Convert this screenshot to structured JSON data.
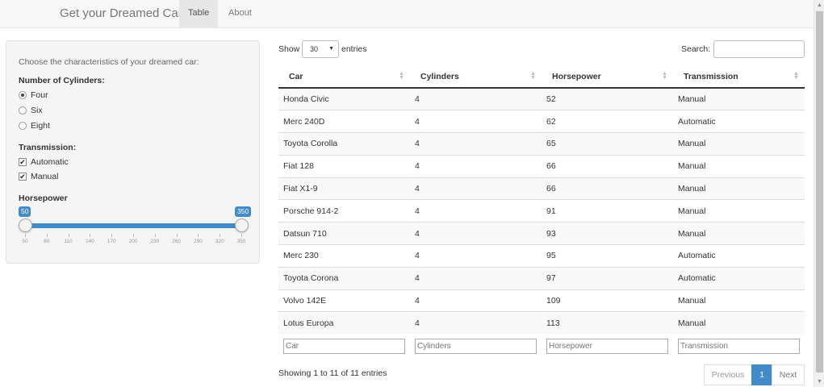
{
  "navbar": {
    "brand": "Get your Dreamed Car",
    "tabs": [
      {
        "label": "Table",
        "active": true
      },
      {
        "label": "About",
        "active": false
      }
    ]
  },
  "sidebar": {
    "intro": "Choose the characteristics of your dreamed car:",
    "cylinders": {
      "label": "Number of Cylinders:",
      "options": [
        {
          "label": "Four",
          "selected": true
        },
        {
          "label": "Six",
          "selected": false
        },
        {
          "label": "Eight",
          "selected": false
        }
      ]
    },
    "transmission": {
      "label": "Transmission:",
      "options": [
        {
          "label": "Automatic",
          "checked": true
        },
        {
          "label": "Manual",
          "checked": true
        }
      ]
    },
    "horsepower": {
      "label": "Horsepower",
      "min": 50,
      "max": 350,
      "from": "50",
      "to": "350",
      "ticks": [
        "50",
        "80",
        "110",
        "140",
        "170",
        "200",
        "230",
        "260",
        "290",
        "320",
        "350"
      ]
    }
  },
  "table_controls": {
    "show_label": "Show",
    "page_length": "30",
    "entries_label": "entries",
    "search_label": "Search:",
    "search_value": ""
  },
  "table": {
    "columns": [
      "Car",
      "Cylinders",
      "Horsepower",
      "Transmission"
    ],
    "rows": [
      [
        "Honda Civic",
        "4",
        "52",
        "Manual"
      ],
      [
        "Merc 240D",
        "4",
        "62",
        "Automatic"
      ],
      [
        "Toyota Corolla",
        "4",
        "65",
        "Manual"
      ],
      [
        "Fiat 128",
        "4",
        "66",
        "Manual"
      ],
      [
        "Fiat X1-9",
        "4",
        "66",
        "Manual"
      ],
      [
        "Porsche 914-2",
        "4",
        "91",
        "Manual"
      ],
      [
        "Datsun 710",
        "4",
        "93",
        "Manual"
      ],
      [
        "Merc 230",
        "4",
        "95",
        "Automatic"
      ],
      [
        "Toyota Corona",
        "4",
        "97",
        "Automatic"
      ],
      [
        "Volvo 142E",
        "4",
        "109",
        "Manual"
      ],
      [
        "Lotus Europa",
        "4",
        "113",
        "Manual"
      ]
    ],
    "filter_placeholders": [
      "Car",
      "Cylinders",
      "Horsepower",
      "Transmission"
    ]
  },
  "footer": {
    "info": "Showing 1 to 11 of 11 entries",
    "pagination": {
      "previous": "Previous",
      "current": "1",
      "next": "Next"
    }
  },
  "colors": {
    "accent": "#428bca",
    "navbar_bg": "#f8f8f8",
    "well_bg": "#f5f5f5"
  },
  "icons": {
    "sort": "sort-both-icon",
    "dropdown": "caret-down-icon",
    "scroll_up": "arrow-up-icon",
    "scroll_down": "arrow-down-icon"
  }
}
